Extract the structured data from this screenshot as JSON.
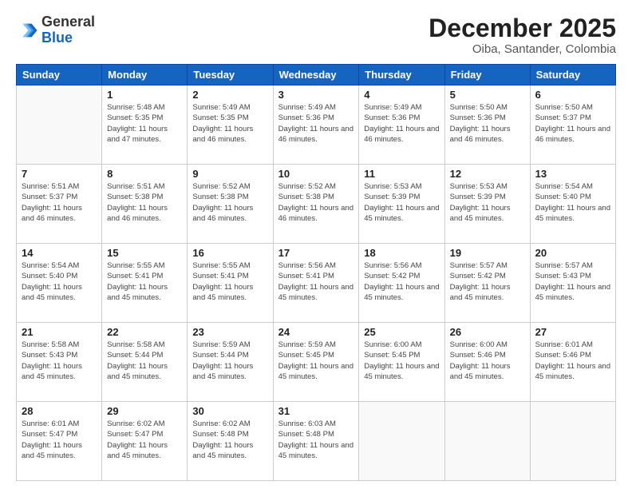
{
  "header": {
    "logo_general": "General",
    "logo_blue": "Blue",
    "month_title": "December 2025",
    "location": "Oiba, Santander, Colombia"
  },
  "days_of_week": [
    "Sunday",
    "Monday",
    "Tuesday",
    "Wednesday",
    "Thursday",
    "Friday",
    "Saturday"
  ],
  "weeks": [
    [
      {
        "day": "",
        "empty": true
      },
      {
        "day": "1",
        "sunrise": "5:48 AM",
        "sunset": "5:35 PM",
        "daylight": "11 hours and 47 minutes."
      },
      {
        "day": "2",
        "sunrise": "5:49 AM",
        "sunset": "5:35 PM",
        "daylight": "11 hours and 46 minutes."
      },
      {
        "day": "3",
        "sunrise": "5:49 AM",
        "sunset": "5:36 PM",
        "daylight": "11 hours and 46 minutes."
      },
      {
        "day": "4",
        "sunrise": "5:49 AM",
        "sunset": "5:36 PM",
        "daylight": "11 hours and 46 minutes."
      },
      {
        "day": "5",
        "sunrise": "5:50 AM",
        "sunset": "5:36 PM",
        "daylight": "11 hours and 46 minutes."
      },
      {
        "day": "6",
        "sunrise": "5:50 AM",
        "sunset": "5:37 PM",
        "daylight": "11 hours and 46 minutes."
      }
    ],
    [
      {
        "day": "7",
        "sunrise": "5:51 AM",
        "sunset": "5:37 PM",
        "daylight": "11 hours and 46 minutes."
      },
      {
        "day": "8",
        "sunrise": "5:51 AM",
        "sunset": "5:38 PM",
        "daylight": "11 hours and 46 minutes."
      },
      {
        "day": "9",
        "sunrise": "5:52 AM",
        "sunset": "5:38 PM",
        "daylight": "11 hours and 46 minutes."
      },
      {
        "day": "10",
        "sunrise": "5:52 AM",
        "sunset": "5:38 PM",
        "daylight": "11 hours and 46 minutes."
      },
      {
        "day": "11",
        "sunrise": "5:53 AM",
        "sunset": "5:39 PM",
        "daylight": "11 hours and 45 minutes."
      },
      {
        "day": "12",
        "sunrise": "5:53 AM",
        "sunset": "5:39 PM",
        "daylight": "11 hours and 45 minutes."
      },
      {
        "day": "13",
        "sunrise": "5:54 AM",
        "sunset": "5:40 PM",
        "daylight": "11 hours and 45 minutes."
      }
    ],
    [
      {
        "day": "14",
        "sunrise": "5:54 AM",
        "sunset": "5:40 PM",
        "daylight": "11 hours and 45 minutes."
      },
      {
        "day": "15",
        "sunrise": "5:55 AM",
        "sunset": "5:41 PM",
        "daylight": "11 hours and 45 minutes."
      },
      {
        "day": "16",
        "sunrise": "5:55 AM",
        "sunset": "5:41 PM",
        "daylight": "11 hours and 45 minutes."
      },
      {
        "day": "17",
        "sunrise": "5:56 AM",
        "sunset": "5:41 PM",
        "daylight": "11 hours and 45 minutes."
      },
      {
        "day": "18",
        "sunrise": "5:56 AM",
        "sunset": "5:42 PM",
        "daylight": "11 hours and 45 minutes."
      },
      {
        "day": "19",
        "sunrise": "5:57 AM",
        "sunset": "5:42 PM",
        "daylight": "11 hours and 45 minutes."
      },
      {
        "day": "20",
        "sunrise": "5:57 AM",
        "sunset": "5:43 PM",
        "daylight": "11 hours and 45 minutes."
      }
    ],
    [
      {
        "day": "21",
        "sunrise": "5:58 AM",
        "sunset": "5:43 PM",
        "daylight": "11 hours and 45 minutes."
      },
      {
        "day": "22",
        "sunrise": "5:58 AM",
        "sunset": "5:44 PM",
        "daylight": "11 hours and 45 minutes."
      },
      {
        "day": "23",
        "sunrise": "5:59 AM",
        "sunset": "5:44 PM",
        "daylight": "11 hours and 45 minutes."
      },
      {
        "day": "24",
        "sunrise": "5:59 AM",
        "sunset": "5:45 PM",
        "daylight": "11 hours and 45 minutes."
      },
      {
        "day": "25",
        "sunrise": "6:00 AM",
        "sunset": "5:45 PM",
        "daylight": "11 hours and 45 minutes."
      },
      {
        "day": "26",
        "sunrise": "6:00 AM",
        "sunset": "5:46 PM",
        "daylight": "11 hours and 45 minutes."
      },
      {
        "day": "27",
        "sunrise": "6:01 AM",
        "sunset": "5:46 PM",
        "daylight": "11 hours and 45 minutes."
      }
    ],
    [
      {
        "day": "28",
        "sunrise": "6:01 AM",
        "sunset": "5:47 PM",
        "daylight": "11 hours and 45 minutes."
      },
      {
        "day": "29",
        "sunrise": "6:02 AM",
        "sunset": "5:47 PM",
        "daylight": "11 hours and 45 minutes."
      },
      {
        "day": "30",
        "sunrise": "6:02 AM",
        "sunset": "5:48 PM",
        "daylight": "11 hours and 45 minutes."
      },
      {
        "day": "31",
        "sunrise": "6:03 AM",
        "sunset": "5:48 PM",
        "daylight": "11 hours and 45 minutes."
      },
      {
        "day": "",
        "empty": true
      },
      {
        "day": "",
        "empty": true
      },
      {
        "day": "",
        "empty": true
      }
    ]
  ]
}
